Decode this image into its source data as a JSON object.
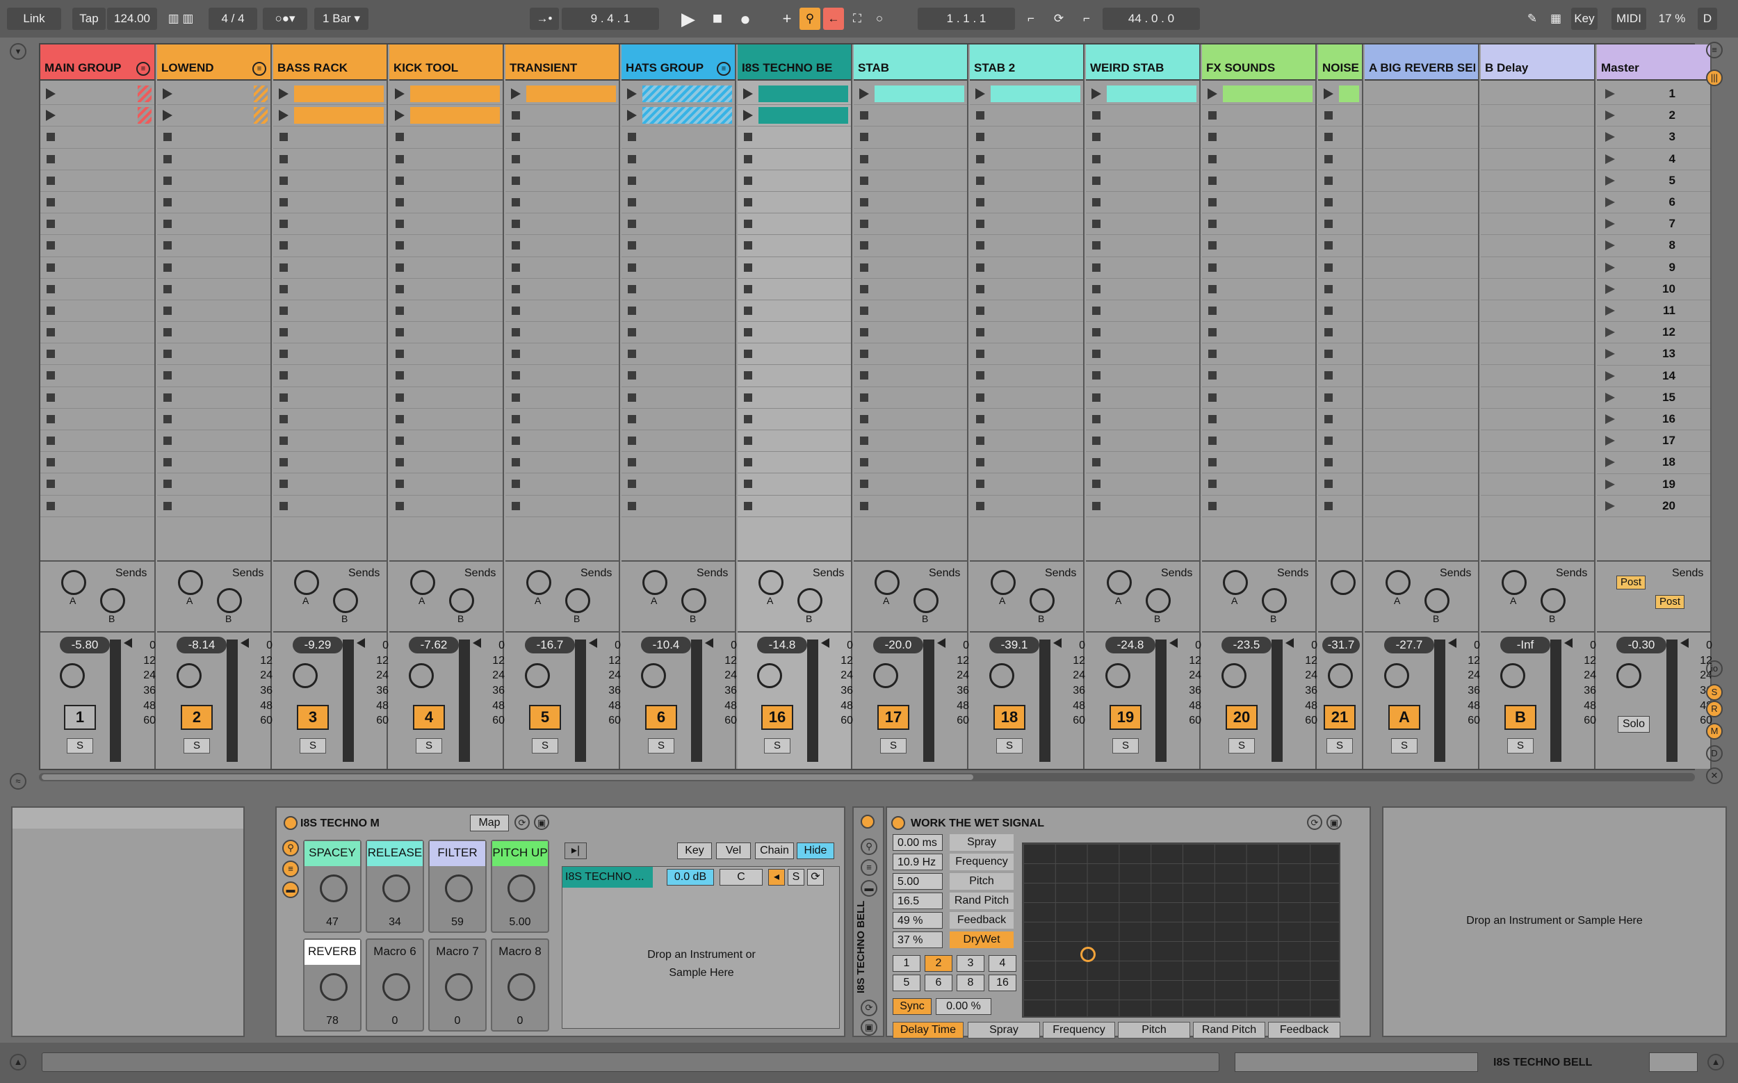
{
  "transport": {
    "link": "Link",
    "tap": "Tap",
    "tempo": "124.00",
    "signature": "4 / 4",
    "quantize": "1 Bar",
    "position": "9 .  4 .  1",
    "loop_start": "1 .  1 .  1",
    "loop_length": "44 .  0 .  0",
    "key": "Key",
    "midi": "MIDI",
    "cpu": "17 %",
    "d": "D"
  },
  "tracks": [
    {
      "name": "MAIN GROUP",
      "color": "#ef5b5b",
      "vol": "-5.80",
      "num": "1",
      "numgrey": true,
      "group": true
    },
    {
      "name": "LOWEND",
      "color": "#f2a33a",
      "vol": "-8.14",
      "num": "2",
      "group": true
    },
    {
      "name": "BASS RACK",
      "color": "#f2a33a",
      "vol": "-9.29",
      "num": "3"
    },
    {
      "name": "KICK TOOL",
      "color": "#f2a33a",
      "vol": "-7.62",
      "num": "4"
    },
    {
      "name": "TRANSIENT",
      "color": "#f2a33a",
      "vol": "-16.7",
      "num": "5"
    },
    {
      "name": "HATS GROUP",
      "color": "#37b3e6",
      "vol": "-10.4",
      "num": "6",
      "group": true
    },
    {
      "name": "I8S TECHNO BE",
      "color": "#1e9e90",
      "vol": "-14.8",
      "num": "16"
    },
    {
      "name": "STAB",
      "color": "#7ee8d9",
      "vol": "-20.0",
      "num": "17"
    },
    {
      "name": "STAB 2",
      "color": "#7ee8d9",
      "vol": "-39.1",
      "num": "18"
    },
    {
      "name": "WEIRD STAB",
      "color": "#7ee8d9",
      "vol": "-24.8",
      "num": "19"
    },
    {
      "name": "FX SOUNDS",
      "color": "#9be07a",
      "vol": "-23.5",
      "num": "20"
    },
    {
      "name": "NOISE F",
      "color": "#9be07a",
      "vol": "-31.7",
      "num": "21"
    },
    {
      "name": "A BIG REVERB SEN",
      "color": "#9db4e8",
      "vol": "-27.7",
      "num": "A"
    },
    {
      "name": "B Delay",
      "color": "#c4c8f0",
      "vol": "-Inf",
      "num": "B"
    },
    {
      "name": "Master",
      "color": "#c9b6e8",
      "vol": "-0.30",
      "num": ""
    }
  ],
  "sends_label": "Sends",
  "knob_a": "A",
  "knob_b": "B",
  "solo_label": "S",
  "master_solo": "Solo",
  "post": "Post",
  "db_scale": [
    "0",
    "12",
    "24",
    "36",
    "48",
    "60"
  ],
  "scenes": [
    "1",
    "2",
    "3",
    "4",
    "5",
    "6",
    "7",
    "8",
    "9",
    "10",
    "11",
    "12",
    "13",
    "14",
    "15",
    "16",
    "17",
    "18",
    "19",
    "20"
  ],
  "rack": {
    "title": "I8S TECHNO M",
    "map": "Map",
    "macros": [
      {
        "name": "SPACEY",
        "value": "47",
        "color": "#7ee8c0"
      },
      {
        "name": "RELEASE",
        "value": "34",
        "color": "#7ee8d9"
      },
      {
        "name": "FILTER",
        "value": "59",
        "color": "#c4c8f0"
      },
      {
        "name": "PITCH UP",
        "value": "5.00",
        "color": "#6de86d"
      },
      {
        "name": "REVERB",
        "value": "78",
        "color": "#ffffff"
      },
      {
        "name": "Macro 6",
        "value": "0",
        "color": ""
      },
      {
        "name": "Macro 7",
        "value": "0",
        "color": ""
      },
      {
        "name": "Macro 8",
        "value": "0",
        "color": ""
      }
    ],
    "key": "Key",
    "vel": "Vel",
    "chain": "Chain",
    "hide": "Hide",
    "chain_name": "I8S TECHNO ...",
    "chain_vol": "0.0 dB",
    "chain_pan": "C",
    "chain_s": "S",
    "drop": "Drop an Instrument or Sample Here"
  },
  "device_side_label": "I8S TECHNO BELL",
  "effect": {
    "title": "WORK THE WET SIGNAL",
    "params": [
      {
        "value": "0.00 ms",
        "name": "Spray"
      },
      {
        "value": "10.9 Hz",
        "name": "Frequency"
      },
      {
        "value": "5.00",
        "name": "Pitch"
      },
      {
        "value": "16.5",
        "name": "Rand Pitch"
      },
      {
        "value": "49 %",
        "name": "Feedback"
      },
      {
        "value": "37 %",
        "name": "DryWet"
      }
    ],
    "divs": [
      "1",
      "2",
      "3",
      "4",
      "5",
      "6",
      "8",
      "16"
    ],
    "sync": "Sync",
    "sync_val": "0.00 %",
    "tabs": [
      "Delay Time",
      "Spray",
      "Frequency",
      "Pitch",
      "Rand Pitch",
      "Feedback"
    ]
  },
  "drop_right": "Drop an Instrument or Sample Here",
  "status_track": "I8S TECHNO BELL"
}
